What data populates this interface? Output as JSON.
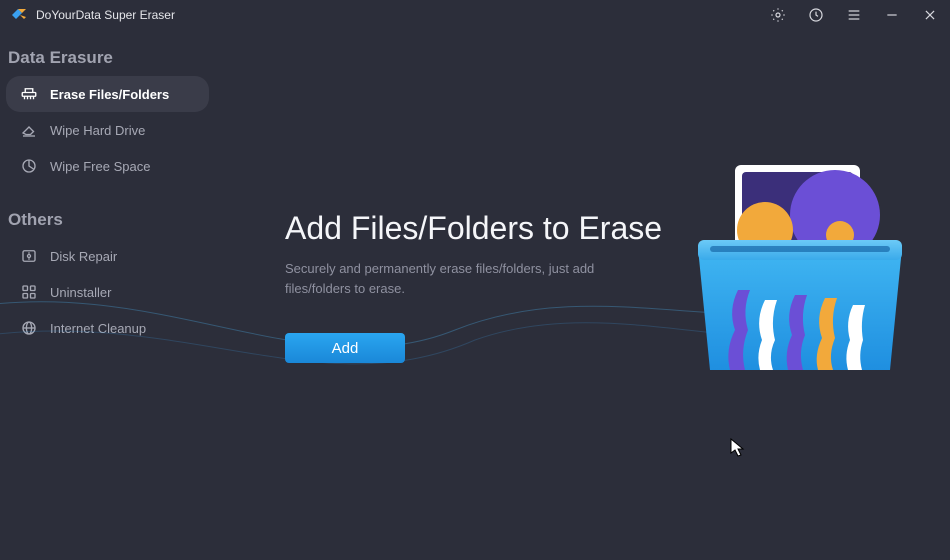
{
  "app": {
    "title": "DoYourData Super Eraser"
  },
  "sidebar": {
    "sections": {
      "dataErasure": {
        "header": "Data Erasure",
        "items": [
          {
            "label": "Erase Files/Folders"
          },
          {
            "label": "Wipe Hard Drive"
          },
          {
            "label": "Wipe Free Space"
          }
        ]
      },
      "others": {
        "header": "Others",
        "items": [
          {
            "label": "Disk Repair"
          },
          {
            "label": "Uninstaller"
          },
          {
            "label": "Internet Cleanup"
          }
        ]
      }
    }
  },
  "main": {
    "title": "Add Files/Folders to Erase",
    "description": "Securely and permanently erase files/folders, just add files/folders to erase.",
    "addButton": "Add"
  }
}
